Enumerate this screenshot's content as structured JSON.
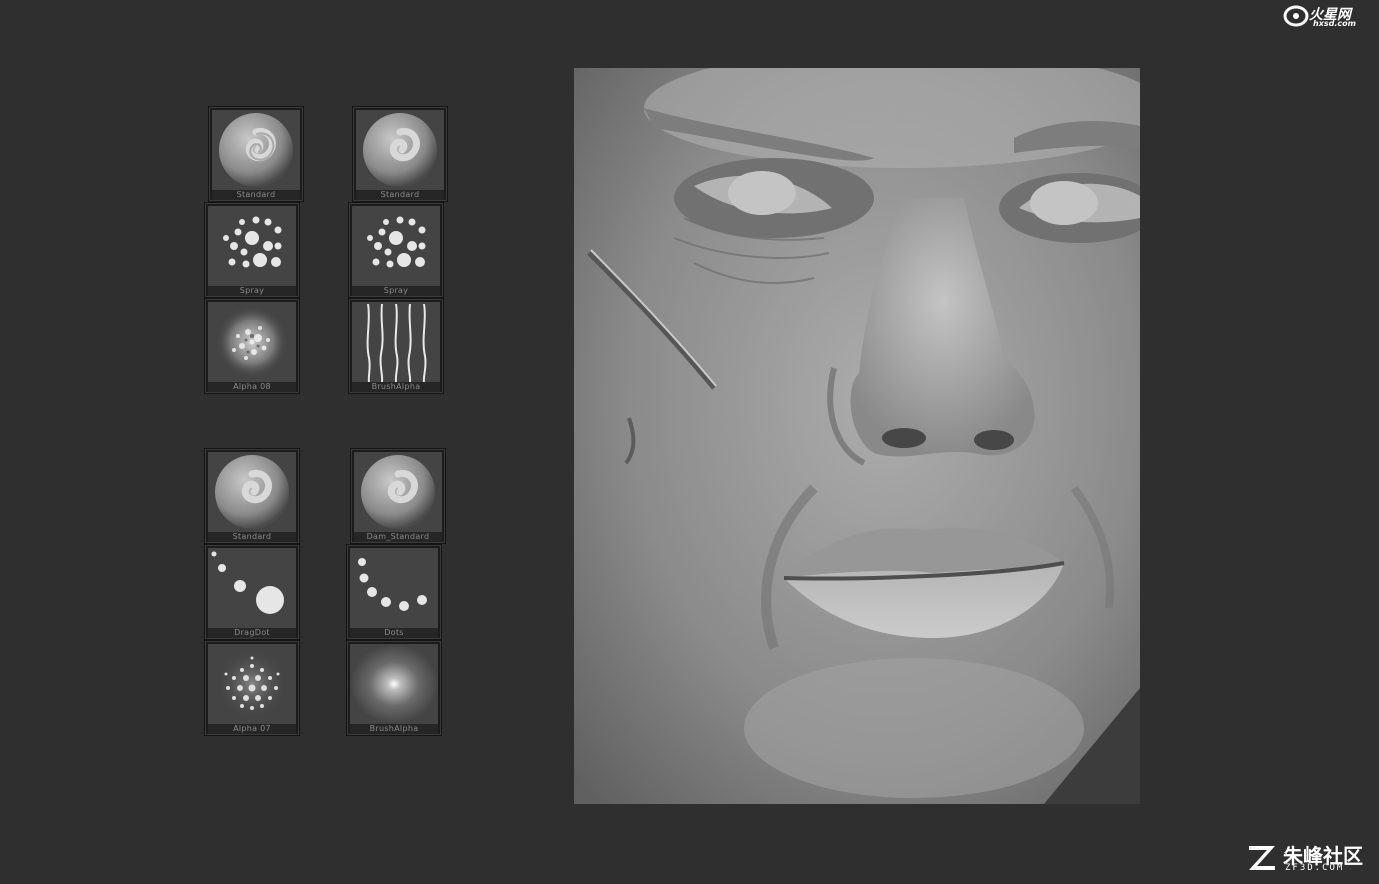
{
  "watermark_top": {
    "brand": "火星网",
    "url": "hxsd.com"
  },
  "watermark_bottom": {
    "brand": "朱峰社区",
    "url": "ZF3D.COM"
  },
  "palettes": [
    {
      "columns": [
        {
          "slots": [
            {
              "label": "Standard",
              "icon": "standard-brush-icon"
            },
            {
              "label": "Spray",
              "icon": "spray-stroke-icon"
            },
            {
              "label": "Alpha 08",
              "icon": "noise-alpha-icon"
            }
          ]
        },
        {
          "slots": [
            {
              "label": "Standard",
              "icon": "standard-brush-icon"
            },
            {
              "label": "Spray",
              "icon": "spray-stroke-icon"
            },
            {
              "label": "BrushAlpha",
              "icon": "wavy-lines-alpha-icon"
            }
          ]
        }
      ]
    },
    {
      "columns": [
        {
          "slots": [
            {
              "label": "Standard",
              "icon": "standard-brush-icon"
            },
            {
              "label": "DragDot",
              "icon": "dragdot-stroke-icon"
            },
            {
              "label": "Alpha 07",
              "icon": "dots-alpha-icon"
            }
          ]
        },
        {
          "slots": [
            {
              "label": "Dam_Standard",
              "icon": "standard-brush-icon"
            },
            {
              "label": "Dots",
              "icon": "dots-stroke-icon"
            },
            {
              "label": "BrushAlpha",
              "icon": "soft-gradient-alpha-icon"
            }
          ]
        }
      ]
    }
  ]
}
